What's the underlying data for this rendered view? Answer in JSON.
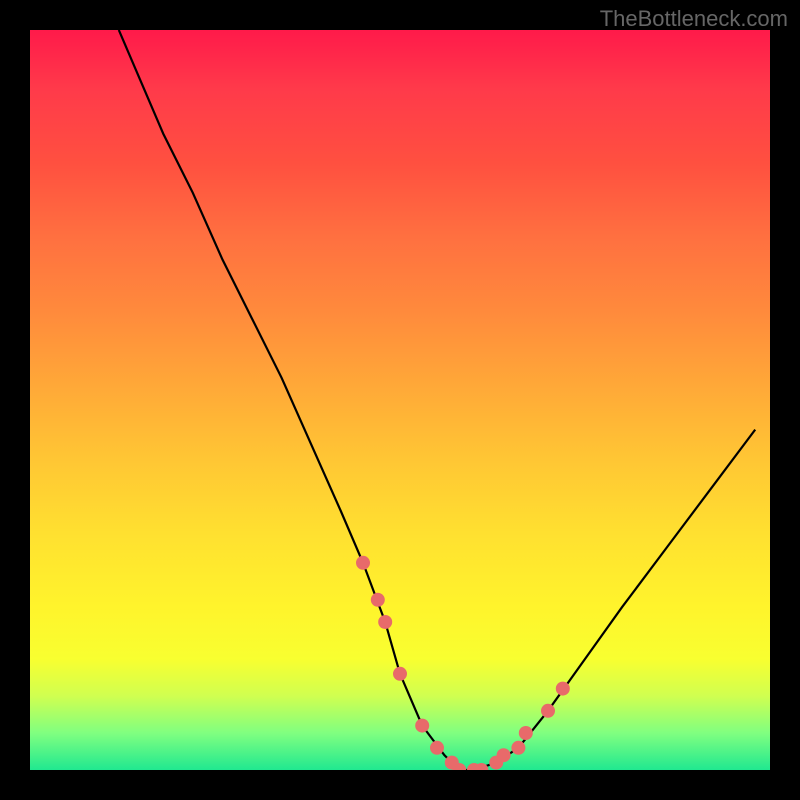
{
  "watermark": "TheBottleneck.com",
  "chart_data": {
    "type": "line",
    "title": "",
    "xlabel": "",
    "ylabel": "",
    "x_range": [
      0,
      100
    ],
    "y_range": [
      0,
      100
    ],
    "series": [
      {
        "name": "bottleneck-curve",
        "x": [
          12,
          15,
          18,
          22,
          26,
          30,
          34,
          38,
          42,
          45,
          48,
          50,
          53,
          56,
          58,
          60,
          63,
          66,
          70,
          75,
          80,
          86,
          92,
          98
        ],
        "y": [
          100,
          93,
          86,
          78,
          69,
          61,
          53,
          44,
          35,
          28,
          20,
          13,
          6,
          2,
          0,
          0,
          1,
          3,
          8,
          15,
          22,
          30,
          38,
          46
        ]
      }
    ],
    "markers": {
      "name": "highlight-points",
      "color": "#e86a6a",
      "x": [
        45,
        47,
        48,
        50,
        53,
        55,
        57,
        58,
        60,
        61,
        63,
        64,
        66,
        67,
        70,
        72
      ],
      "y": [
        28,
        23,
        20,
        13,
        6,
        3,
        1,
        0,
        0,
        0,
        1,
        2,
        3,
        5,
        8,
        11
      ]
    },
    "gradient_stops": [
      {
        "pos": 0,
        "color": "#ff1a4a"
      },
      {
        "pos": 50,
        "color": "#ffb030"
      },
      {
        "pos": 85,
        "color": "#fff030"
      },
      {
        "pos": 100,
        "color": "#20e890"
      }
    ]
  }
}
